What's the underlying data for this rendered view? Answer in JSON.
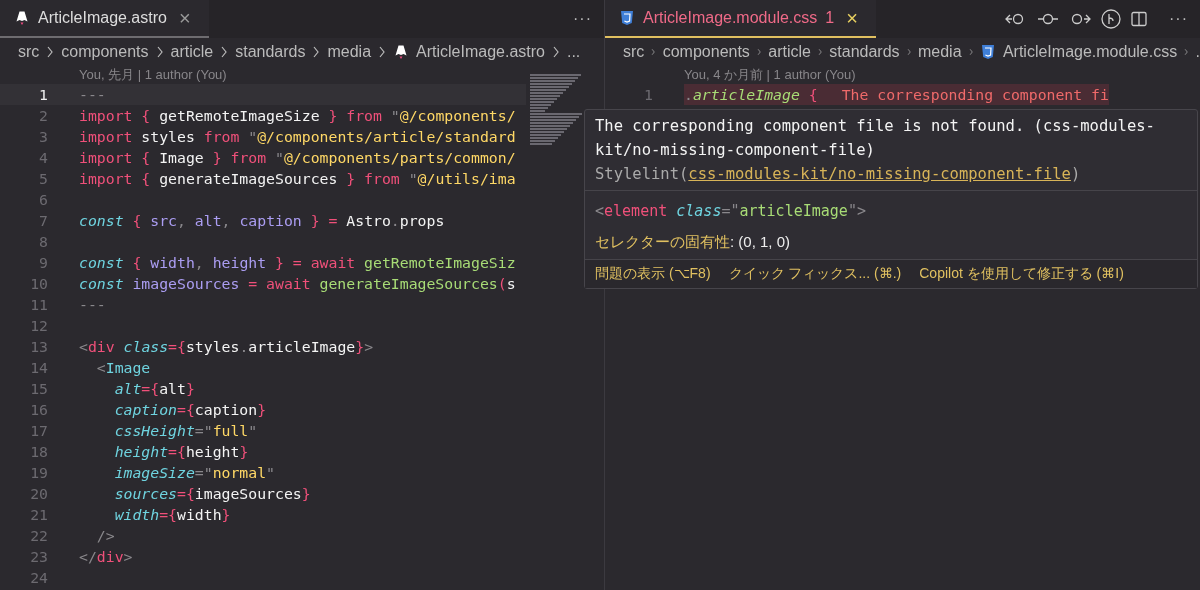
{
  "left_pane": {
    "tab": {
      "label": "ArticleImage.astro",
      "close": "×",
      "focused": false
    },
    "more": "···",
    "breadcrumbs": [
      {
        "label": "src",
        "kind": "folder"
      },
      {
        "label": "components",
        "kind": "folder"
      },
      {
        "label": "article",
        "kind": "folder"
      },
      {
        "label": "standards",
        "kind": "folder"
      },
      {
        "label": "media",
        "kind": "folder"
      },
      {
        "label": "ArticleImage.astro",
        "kind": "file"
      },
      {
        "label": "...",
        "kind": "folder"
      }
    ],
    "blame": "You, 先月 | 1 author (You)",
    "lines": [
      {
        "number": "1",
        "current": true,
        "tokens": [
          {
            "t": "---",
            "kind": "comment"
          }
        ]
      },
      {
        "number": "2",
        "current": false,
        "tokens": [
          {
            "t": "import",
            "kind": "keyword"
          },
          {
            "t": " { ",
            "kind": "punct"
          },
          {
            "t": "getRemoteImageSize",
            "kind": "plain"
          },
          {
            "t": " } ",
            "kind": "punct"
          },
          {
            "t": "from",
            "kind": "keyword"
          },
          {
            "t": " \"",
            "kind": "comment"
          },
          {
            "t": "@/components/",
            "kind": "string"
          }
        ]
      },
      {
        "number": "3",
        "current": false,
        "tokens": [
          {
            "t": "import",
            "kind": "keyword"
          },
          {
            "t": " styles ",
            "kind": "plain"
          },
          {
            "t": "from",
            "kind": "keyword"
          },
          {
            "t": " \"",
            "kind": "comment"
          },
          {
            "t": "@/components/article/standard",
            "kind": "string"
          }
        ]
      },
      {
        "number": "4",
        "current": false,
        "tokens": [
          {
            "t": "import",
            "kind": "keyword"
          },
          {
            "t": " { ",
            "kind": "punct"
          },
          {
            "t": "Image",
            "kind": "plain"
          },
          {
            "t": " } ",
            "kind": "punct"
          },
          {
            "t": "from",
            "kind": "keyword"
          },
          {
            "t": " \"",
            "kind": "comment"
          },
          {
            "t": "@/components/parts/common/",
            "kind": "string"
          }
        ]
      },
      {
        "number": "5",
        "current": false,
        "tokens": [
          {
            "t": "import",
            "kind": "keyword"
          },
          {
            "t": " { ",
            "kind": "punct"
          },
          {
            "t": "generateImageSources",
            "kind": "plain"
          },
          {
            "t": " } ",
            "kind": "punct"
          },
          {
            "t": "from",
            "kind": "keyword"
          },
          {
            "t": " \"",
            "kind": "comment"
          },
          {
            "t": "@/utils/ima",
            "kind": "string"
          }
        ]
      },
      {
        "number": "6",
        "current": false
      },
      {
        "number": "7",
        "current": false,
        "tokens": [
          {
            "t": "const",
            "kind": "storage"
          },
          {
            "t": " { ",
            "kind": "punct"
          },
          {
            "t": "src",
            "kind": "variable"
          },
          {
            "t": ", ",
            "kind": "comment"
          },
          {
            "t": "alt",
            "kind": "variable"
          },
          {
            "t": ", ",
            "kind": "comment"
          },
          {
            "t": "caption",
            "kind": "variable"
          },
          {
            "t": " } = ",
            "kind": "punct"
          },
          {
            "t": "Astro",
            "kind": "plain"
          },
          {
            "t": ".",
            "kind": "comment"
          },
          {
            "t": "props",
            "kind": "plain"
          }
        ]
      },
      {
        "number": "8",
        "current": false
      },
      {
        "number": "9",
        "current": false,
        "tokens": [
          {
            "t": "const",
            "kind": "storage"
          },
          {
            "t": " { ",
            "kind": "punct"
          },
          {
            "t": "width",
            "kind": "variable"
          },
          {
            "t": ", ",
            "kind": "comment"
          },
          {
            "t": "height",
            "kind": "variable"
          },
          {
            "t": " } = ",
            "kind": "punct"
          },
          {
            "t": "await",
            "kind": "keyword"
          },
          {
            "t": " getRemoteImageSiz",
            "kind": "function"
          }
        ]
      },
      {
        "number": "10",
        "current": false,
        "tokens": [
          {
            "t": "const",
            "kind": "storage"
          },
          {
            "t": " imageSources",
            "kind": "variable"
          },
          {
            "t": " = ",
            "kind": "punct"
          },
          {
            "t": "await",
            "kind": "keyword"
          },
          {
            "t": " generateImageSources",
            "kind": "function"
          },
          {
            "t": "(",
            "kind": "punct"
          },
          {
            "t": "s",
            "kind": "plain"
          }
        ]
      },
      {
        "number": "11",
        "current": false,
        "tokens": [
          {
            "t": "---",
            "kind": "comment"
          }
        ]
      },
      {
        "number": "12",
        "current": false
      },
      {
        "number": "13",
        "current": false,
        "tokens": [
          {
            "t": "<",
            "kind": "comment"
          },
          {
            "t": "div",
            "kind": "keyword"
          },
          {
            "t": " class",
            "kind": "storage"
          },
          {
            "t": "={",
            "kind": "punct"
          },
          {
            "t": "styles",
            "kind": "plain"
          },
          {
            "t": ".",
            "kind": "comment"
          },
          {
            "t": "articleImage",
            "kind": "plain"
          },
          {
            "t": "}",
            "kind": "punct"
          },
          {
            "t": ">",
            "kind": "comment"
          }
        ]
      },
      {
        "number": "14",
        "current": false,
        "tokens": [
          {
            "t": "  <",
            "kind": "comment"
          },
          {
            "t": "Image",
            "kind": "component"
          }
        ]
      },
      {
        "number": "15",
        "current": false,
        "tokens": [
          {
            "t": "    alt",
            "kind": "storage"
          },
          {
            "t": "={",
            "kind": "punct"
          },
          {
            "t": "alt",
            "kind": "plain"
          },
          {
            "t": "}",
            "kind": "punct"
          }
        ]
      },
      {
        "number": "16",
        "current": false,
        "tokens": [
          {
            "t": "    caption",
            "kind": "storage"
          },
          {
            "t": "={",
            "kind": "punct"
          },
          {
            "t": "caption",
            "kind": "plain"
          },
          {
            "t": "}",
            "kind": "punct"
          }
        ]
      },
      {
        "number": "17",
        "current": false,
        "tokens": [
          {
            "t": "    cssHeight",
            "kind": "storage"
          },
          {
            "t": "=\"",
            "kind": "comment"
          },
          {
            "t": "full",
            "kind": "string"
          },
          {
            "t": "\"",
            "kind": "comment"
          }
        ]
      },
      {
        "number": "18",
        "current": false,
        "tokens": [
          {
            "t": "    height",
            "kind": "storage"
          },
          {
            "t": "={",
            "kind": "punct"
          },
          {
            "t": "height",
            "kind": "plain"
          },
          {
            "t": "}",
            "kind": "punct"
          }
        ]
      },
      {
        "number": "19",
        "current": false,
        "tokens": [
          {
            "t": "    imageSize",
            "kind": "storage"
          },
          {
            "t": "=\"",
            "kind": "comment"
          },
          {
            "t": "normal",
            "kind": "string"
          },
          {
            "t": "\"",
            "kind": "comment"
          }
        ]
      },
      {
        "number": "20",
        "current": false,
        "tokens": [
          {
            "t": "    sources",
            "kind": "storage"
          },
          {
            "t": "={",
            "kind": "punct"
          },
          {
            "t": "imageSources",
            "kind": "plain"
          },
          {
            "t": "}",
            "kind": "punct"
          }
        ]
      },
      {
        "number": "21",
        "current": false,
        "tokens": [
          {
            "t": "    width",
            "kind": "storage"
          },
          {
            "t": "={",
            "kind": "punct"
          },
          {
            "t": "width",
            "kind": "plain"
          },
          {
            "t": "}",
            "kind": "punct"
          }
        ]
      },
      {
        "number": "22",
        "current": false,
        "tokens": [
          {
            "t": "  />",
            "kind": "comment"
          }
        ]
      },
      {
        "number": "23",
        "current": false,
        "tokens": [
          {
            "t": "</",
            "kind": "comment"
          },
          {
            "t": "div",
            "kind": "keyword"
          },
          {
            "t": ">",
            "kind": "comment"
          }
        ]
      },
      {
        "number": "24",
        "current": false
      }
    ]
  },
  "right_pane": {
    "tab": {
      "label": "ArticleImage.module.css",
      "problems": "1",
      "close": "×",
      "focused": true
    },
    "more": "···",
    "breadcrumbs": [
      {
        "label": "src",
        "kind": "folder"
      },
      {
        "label": "components",
        "kind": "folder"
      },
      {
        "label": "article",
        "kind": "folder"
      },
      {
        "label": "standards",
        "kind": "folder"
      },
      {
        "label": "media",
        "kind": "folder"
      },
      {
        "label": "ArticleImage.module.css",
        "kind": "file"
      },
      {
        "label": ".",
        "kind": "folder"
      }
    ],
    "blame": "You, 4 か月前 | 1 author (You)",
    "lines": [
      {
        "number": "1",
        "error": true,
        "tokens": [
          {
            "t": ".",
            "kind": "comment"
          },
          {
            "t": "articleImage",
            "kind": "selector"
          },
          {
            "t": " {",
            "kind": "punct"
          }
        ],
        "inline_error": "The corresponding component fi"
      }
    ],
    "hover": {
      "message": "The corresponding component file is not found. (css-modules-kit/no-missing-component-file)",
      "source": "Stylelint(",
      "rule_link": "css-modules-kit/no-missing-component-file",
      "source_end": ")",
      "code": [
        {
          "t": "<",
          "kind": "comment"
        },
        {
          "t": "element",
          "kind": "keyword"
        },
        {
          "t": " class",
          "kind": "storage"
        },
        {
          "t": "=\"",
          "kind": "comment"
        },
        {
          "t": "articleImage",
          "kind": "function"
        },
        {
          "t": "\">",
          "kind": "comment"
        }
      ],
      "specificity_label": "セレクターの固有性",
      "specificity_value": ": (0, 1, 0)",
      "actions": [
        "問題の表示 (⌥F8)",
        "クイック フィックス... (⌘.)",
        "Copilot を使用して修正する (⌘I)"
      ]
    }
  }
}
